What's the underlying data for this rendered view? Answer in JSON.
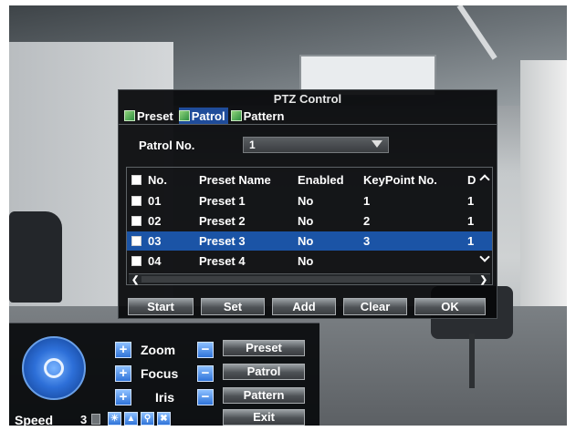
{
  "dialog": {
    "title": "PTZ Control",
    "tabs": [
      {
        "label": "Preset",
        "active": false
      },
      {
        "label": "Patrol",
        "active": true
      },
      {
        "label": "Pattern",
        "active": false
      }
    ],
    "patrol_no_label": "Patrol No.",
    "patrol_no_value": "1",
    "table": {
      "headers": {
        "no": "No.",
        "name": "Preset Name",
        "enabled": "Enabled",
        "keypoint": "KeyPoint No.",
        "d": "D"
      },
      "rows": [
        {
          "no": "01",
          "name": "Preset 1",
          "enabled": "No",
          "keypoint": "1",
          "d": "1",
          "selected": false
        },
        {
          "no": "02",
          "name": "Preset 2",
          "enabled": "No",
          "keypoint": "2",
          "d": "1",
          "selected": false
        },
        {
          "no": "03",
          "name": "Preset 3",
          "enabled": "No",
          "keypoint": "3",
          "d": "1",
          "selected": true
        },
        {
          "no": "04",
          "name": "Preset 4",
          "enabled": "No",
          "keypoint": "",
          "d": "",
          "selected": false
        }
      ]
    },
    "buttons": {
      "start": "Start",
      "set": "Set",
      "add": "Add",
      "clear": "Clear",
      "ok": "OK"
    }
  },
  "ptz_panel": {
    "zoom_label": "Zoom",
    "focus_label": "Focus",
    "iris_label": "Iris",
    "preset_button": "Preset",
    "patrol_button": "Patrol",
    "pattern_button": "Pattern",
    "exit_button": "Exit",
    "speed_label": "Speed",
    "speed_value": "3"
  },
  "colors": {
    "selection": "#1b54a6",
    "tab_active": "#1f4c9a",
    "accent_blue": "#2f74d9"
  }
}
